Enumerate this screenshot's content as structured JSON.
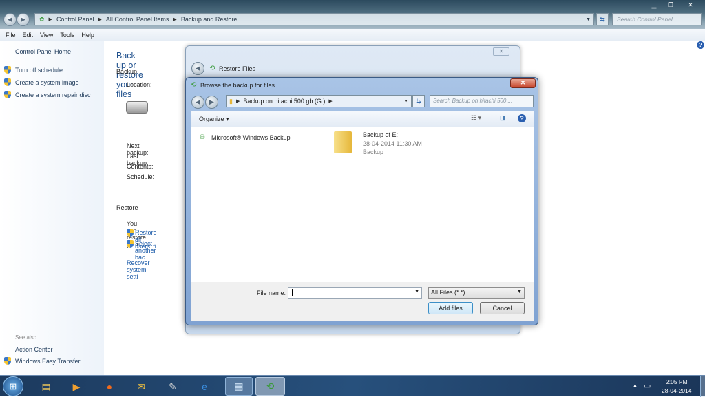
{
  "window": {
    "breadcrumbs": [
      "Control Panel",
      "All Control Panel Items",
      "Backup and Restore"
    ],
    "search_placeholder": "Search Control Panel"
  },
  "menu": [
    "File",
    "Edit",
    "View",
    "Tools",
    "Help"
  ],
  "sidebar": {
    "home": "Control Panel Home",
    "tasks": [
      "Turn off schedule",
      "Create a system image",
      "Create a system repair disc"
    ],
    "see_also": "See also",
    "see_also_items": [
      "Action Center",
      "Windows Easy Transfer"
    ]
  },
  "main": {
    "title": "Back up or restore your files",
    "backup_section": "Backup",
    "location_label": "Location:",
    "next_backup_label": "Next backup:",
    "last_backup_label": "Last backup:",
    "contents_label": "Contents:",
    "schedule_label": "Schedule:",
    "restore_section": "Restore",
    "restore_text": "You can restore your",
    "restore_all": "Restore all users' fi",
    "select_another": "Select another bac",
    "recover": "Recover system setti"
  },
  "restore_window": {
    "title": "Restore Files"
  },
  "browse_dialog": {
    "title": "Browse the backup for files",
    "path": "Backup on hitachi 500 gb (G:)",
    "search_placeholder": "Search Backup on hitachi 500 ...",
    "organize": "Organize",
    "tree_item": "Microsoft® Windows Backup",
    "file": {
      "name": "Backup of E:",
      "date": "28-04-2014 11:30 AM",
      "type": "Backup"
    },
    "file_name_label": "File name:",
    "file_name_value": "",
    "filter": "All Files (*.*)",
    "add_button": "Add files",
    "cancel_button": "Cancel"
  },
  "taskbar": {
    "time": "2:05 PM",
    "date": "28-04-2014"
  }
}
